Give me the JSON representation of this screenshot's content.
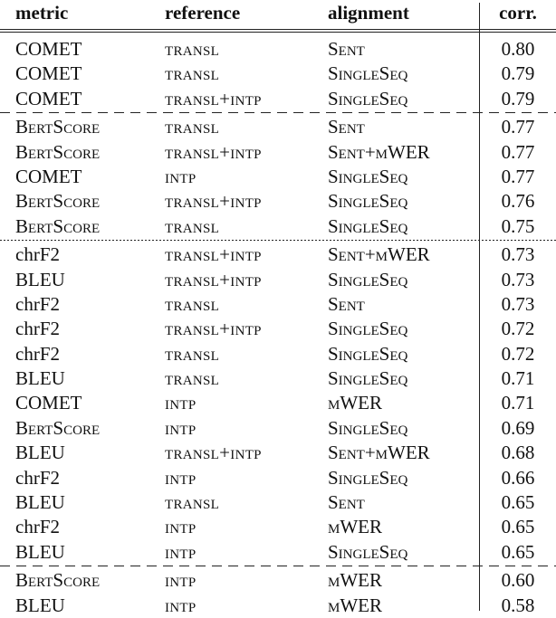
{
  "table": {
    "headers": {
      "metric": "metric",
      "reference": "reference",
      "alignment": "alignment",
      "corr": "corr."
    },
    "groups": [
      {
        "separator_before": "double",
        "rows": [
          {
            "metric": "COMET",
            "reference": "transl",
            "alignment": "Sent",
            "corr": "0.80"
          },
          {
            "metric": "COMET",
            "reference": "transl",
            "alignment": "SingleSeq",
            "corr": "0.79"
          },
          {
            "metric": "COMET",
            "reference": "transl+intp",
            "alignment": "SingleSeq",
            "corr": "0.79"
          }
        ]
      },
      {
        "separator_before": "dashed",
        "rows": [
          {
            "metric": "BertScore",
            "reference": "transl",
            "alignment": "Sent",
            "corr": "0.77"
          },
          {
            "metric": "BertScore",
            "reference": "transl+intp",
            "alignment": "Sent+mWER",
            "corr": "0.77"
          },
          {
            "metric": "COMET",
            "reference": "intp",
            "alignment": "SingleSeq",
            "corr": "0.77"
          },
          {
            "metric": "BertScore",
            "reference": "transl+intp",
            "alignment": "SingleSeq",
            "corr": "0.76"
          },
          {
            "metric": "BertScore",
            "reference": "transl",
            "alignment": "SingleSeq",
            "corr": "0.75"
          }
        ]
      },
      {
        "separator_before": "dotted",
        "rows": [
          {
            "metric": "chrF2",
            "reference": "transl+intp",
            "alignment": "Sent+mWER",
            "corr": "0.73"
          },
          {
            "metric": "BLEU",
            "reference": "transl+intp",
            "alignment": "SingleSeq",
            "corr": "0.73"
          },
          {
            "metric": "chrF2",
            "reference": "transl",
            "alignment": "Sent",
            "corr": "0.73"
          },
          {
            "metric": "chrF2",
            "reference": "transl+intp",
            "alignment": "SingleSeq",
            "corr": "0.72"
          },
          {
            "metric": "chrF2",
            "reference": "transl",
            "alignment": "SingleSeq",
            "corr": "0.72"
          },
          {
            "metric": "BLEU",
            "reference": "transl",
            "alignment": "SingleSeq",
            "corr": "0.71"
          },
          {
            "metric": "COMET",
            "reference": "intp",
            "alignment": "mWER",
            "corr": "0.71"
          },
          {
            "metric": "BertScore",
            "reference": "intp",
            "alignment": "SingleSeq",
            "corr": "0.69"
          },
          {
            "metric": "BLEU",
            "reference": "transl+intp",
            "alignment": "Sent+mWER",
            "corr": "0.68"
          },
          {
            "metric": "chrF2",
            "reference": "intp",
            "alignment": "SingleSeq",
            "corr": "0.66"
          },
          {
            "metric": "BLEU",
            "reference": "transl",
            "alignment": "Sent",
            "corr": "0.65"
          },
          {
            "metric": "chrF2",
            "reference": "intp",
            "alignment": "mWER",
            "corr": "0.65"
          },
          {
            "metric": "BLEU",
            "reference": "intp",
            "alignment": "SingleSeq",
            "corr": "0.65"
          }
        ]
      },
      {
        "separator_before": "dashed",
        "rows": [
          {
            "metric": "BertScore",
            "reference": "intp",
            "alignment": "mWER",
            "corr": "0.60"
          },
          {
            "metric": "BLEU",
            "reference": "intp",
            "alignment": "mWER",
            "corr": "0.58"
          }
        ]
      }
    ]
  },
  "chart_data": {
    "type": "table",
    "columns": [
      "metric",
      "reference",
      "alignment",
      "corr."
    ],
    "rows": [
      [
        "COMET",
        "transl",
        "Sent",
        0.8
      ],
      [
        "COMET",
        "transl",
        "SingleSeq",
        0.79
      ],
      [
        "COMET",
        "transl+intp",
        "SingleSeq",
        0.79
      ],
      [
        "BertScore",
        "transl",
        "Sent",
        0.77
      ],
      [
        "BertScore",
        "transl+intp",
        "Sent+mWER",
        0.77
      ],
      [
        "COMET",
        "intp",
        "SingleSeq",
        0.77
      ],
      [
        "BertScore",
        "transl+intp",
        "SingleSeq",
        0.76
      ],
      [
        "BertScore",
        "transl",
        "SingleSeq",
        0.75
      ],
      [
        "chrF2",
        "transl+intp",
        "Sent+mWER",
        0.73
      ],
      [
        "BLEU",
        "transl+intp",
        "SingleSeq",
        0.73
      ],
      [
        "chrF2",
        "transl",
        "Sent",
        0.73
      ],
      [
        "chrF2",
        "transl+intp",
        "SingleSeq",
        0.72
      ],
      [
        "chrF2",
        "transl",
        "SingleSeq",
        0.72
      ],
      [
        "BLEU",
        "transl",
        "SingleSeq",
        0.71
      ],
      [
        "COMET",
        "intp",
        "mWER",
        0.71
      ],
      [
        "BertScore",
        "intp",
        "SingleSeq",
        0.69
      ],
      [
        "BLEU",
        "transl+intp",
        "Sent+mWER",
        0.68
      ],
      [
        "chrF2",
        "intp",
        "SingleSeq",
        0.66
      ],
      [
        "BLEU",
        "transl",
        "Sent",
        0.65
      ],
      [
        "chrF2",
        "intp",
        "mWER",
        0.65
      ],
      [
        "BLEU",
        "intp",
        "SingleSeq",
        0.65
      ],
      [
        "BertScore",
        "intp",
        "mWER",
        0.6
      ],
      [
        "BLEU",
        "intp",
        "mWER",
        0.58
      ]
    ]
  }
}
